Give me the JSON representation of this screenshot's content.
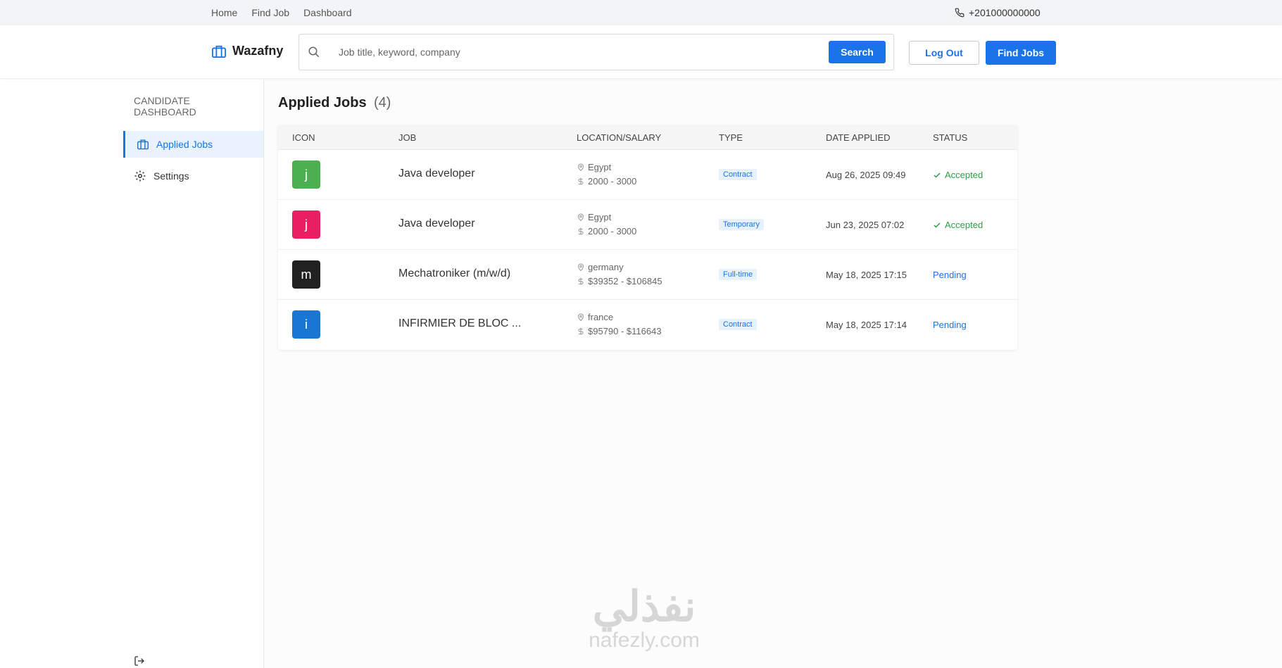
{
  "topnav": {
    "links": [
      "Home",
      "Find Job",
      "Dashboard"
    ],
    "phone": "+201000000000"
  },
  "header": {
    "logo_text": "Wazafny",
    "search_placeholder": "Job title, keyword, company",
    "search_label": "Search",
    "logout_label": "Log Out",
    "find_jobs_label": "Find Jobs"
  },
  "sidebar": {
    "title": "CANDIDATE DASHBOARD",
    "items": [
      {
        "label": "Applied Jobs",
        "icon": "briefcase-icon",
        "active": true
      },
      {
        "label": "Settings",
        "icon": "gear-icon",
        "active": false
      }
    ]
  },
  "main": {
    "title": "Applied Jobs",
    "count": "(4)",
    "columns": [
      "ICON",
      "JOB",
      "LOCATION/SALARY",
      "TYPE",
      "DATE APPLIED",
      "STATUS"
    ],
    "rows": [
      {
        "letter": "j",
        "color": "#4caf50",
        "job": "Java developer",
        "location": "Egypt",
        "salary": "2000 - 3000",
        "type": "Contract",
        "date": "Aug 26, 2025 09:49",
        "status": "Accepted",
        "status_kind": "accepted"
      },
      {
        "letter": "j",
        "color": "#e91e63",
        "job": "Java developer",
        "location": "Egypt",
        "salary": "2000 - 3000",
        "type": "Temporary",
        "date": "Jun 23, 2025 07:02",
        "status": "Accepted",
        "status_kind": "accepted"
      },
      {
        "letter": "m",
        "color": "#212121",
        "job": "Mechatroniker (m/w/d)",
        "location": "germany",
        "salary": "$39352 - $106845",
        "type": "Full-time",
        "date": "May 18, 2025 17:15",
        "status": "Pending",
        "status_kind": "pending"
      },
      {
        "letter": "i",
        "color": "#1976d2",
        "job": "INFIRMIER DE BLOC ...",
        "location": "france",
        "salary": "$95790 - $116643",
        "type": "Contract",
        "date": "May 18, 2025 17:14",
        "status": "Pending",
        "status_kind": "pending"
      }
    ]
  },
  "watermark": {
    "arabic": "نفذلي",
    "latin": "nafezly.com"
  },
  "colors": {
    "accent": "#1a73e8",
    "accepted": "#2e9e45"
  }
}
